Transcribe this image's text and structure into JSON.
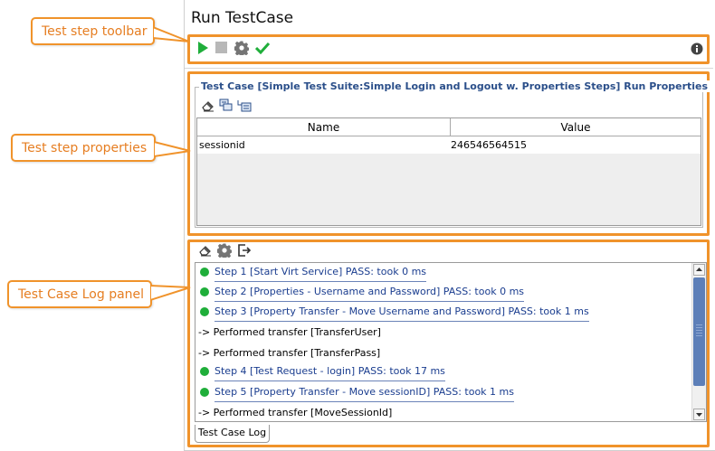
{
  "window": {
    "title": "Run TestCase"
  },
  "callouts": {
    "toolbar": "Test step toolbar",
    "properties": "Test step properties",
    "log": "Test Case Log panel"
  },
  "toolbar": {
    "icons": [
      "run-icon",
      "stop-icon",
      "gear-icon",
      "checkmark-icon",
      "info-icon"
    ]
  },
  "properties": {
    "legend": "Test Case [Simple Test Suite:Simple Login and Logout w. Properties Steps] Run Properties",
    "toolbar_icons": [
      "eraser-icon",
      "copy-icon",
      "transfer-icon"
    ],
    "columns": [
      "Name",
      "Value"
    ],
    "rows": [
      {
        "name": "sessionid",
        "value": "246546564515"
      }
    ]
  },
  "log": {
    "toolbar_icons": [
      "eraser-icon",
      "gear-icon",
      "export-icon"
    ],
    "entries": [
      {
        "type": "step",
        "text": "Step 1 [Start Virt Service] PASS: took 0 ms"
      },
      {
        "type": "step",
        "text": "Step 2 [Properties - Username and Password] PASS: took 0 ms"
      },
      {
        "type": "step",
        "text": "Step 3 [Property Transfer - Move Username and Password] PASS: took 1 ms"
      },
      {
        "type": "text",
        "text": "-> Performed transfer [TransferUser]"
      },
      {
        "type": "text",
        "text": "-> Performed transfer [TransferPass]"
      },
      {
        "type": "step",
        "text": "Step 4 [Test Request - login] PASS: took 17 ms"
      },
      {
        "type": "step",
        "text": "Step 5 [Property Transfer - Move sessionID] PASS: took 1 ms"
      },
      {
        "type": "text",
        "text": "-> Performed transfer [MoveSessionId]"
      }
    ],
    "tab": "Test Case Log"
  },
  "colors": {
    "highlight": "#f0932b",
    "pass": "#1fae3a",
    "link": "#1a3d8f"
  }
}
